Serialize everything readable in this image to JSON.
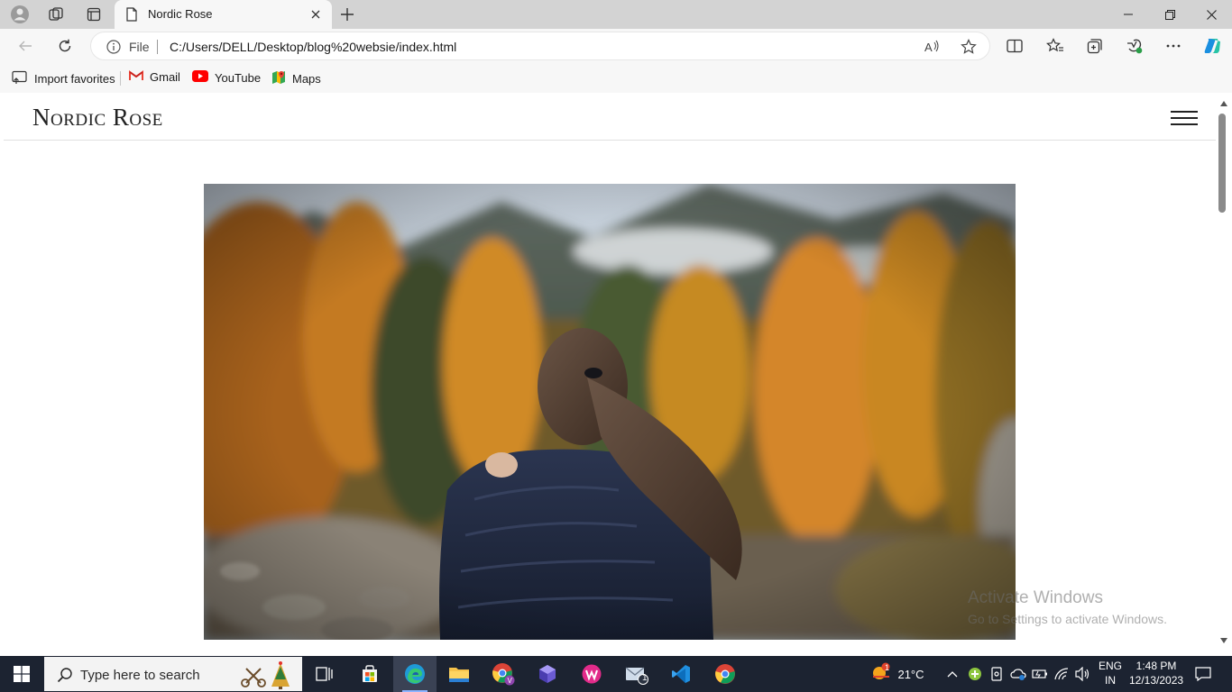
{
  "browser": {
    "tab": {
      "title": "Nordic Rose"
    },
    "address": {
      "scheme_label": "File",
      "url": "C:/Users/DELL/Desktop/blog%20websie/index.html"
    },
    "bookmarks": [
      {
        "label": "Import favorites",
        "icon": "import-icon"
      },
      {
        "label": "Gmail",
        "icon": "gmail-icon"
      },
      {
        "label": "YouTube",
        "icon": "youtube-icon"
      },
      {
        "label": "Maps",
        "icon": "maps-icon"
      }
    ]
  },
  "page": {
    "logo": "Nordic Rose",
    "hero_alt": "Woman with ponytail looking at autumn forest"
  },
  "watermark": {
    "title": "Activate Windows",
    "subtitle": "Go to Settings to activate Windows."
  },
  "taskbar": {
    "search_placeholder": "Type here to search",
    "weather": {
      "temp": "21°C",
      "badge": "1"
    },
    "language": {
      "line1": "ENG",
      "line2": "IN"
    },
    "clock": {
      "time": "1:48 PM",
      "date": "12/13/2023"
    },
    "mail_badge": "1",
    "colors": {
      "bg": "#1c2331",
      "accent": "#8cb4ff"
    }
  }
}
